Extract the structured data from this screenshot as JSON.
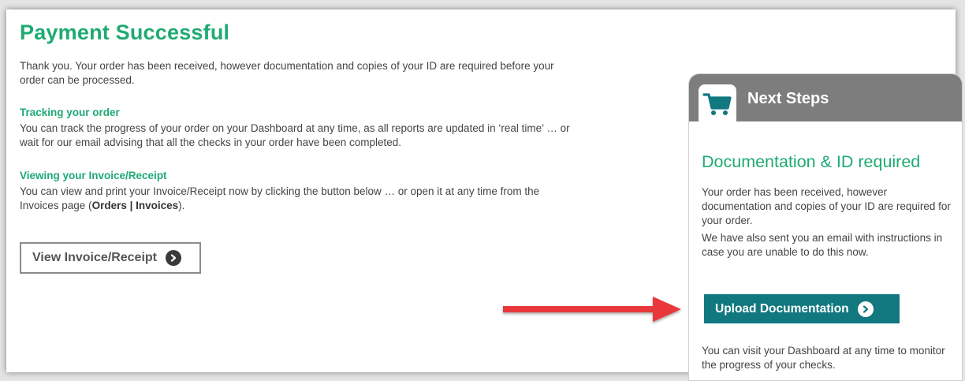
{
  "page": {
    "title": "Payment Successful",
    "intro": "Thank you. Your order has been received, however documentation and copies of your ID are required before your order can be processed."
  },
  "tracking": {
    "heading": "Tracking your order",
    "text": "You can track the progress of your order on your Dashboard at any time, as all reports are updated in ‘real time’ … or wait for our email advising that all the checks in your order have been completed."
  },
  "invoice": {
    "heading": "Viewing your Invoice/Receipt",
    "text_before": "You can view and print your Invoice/Receipt now by clicking the button below … or open it at any time from the Invoices page (",
    "text_bold": "Orders | Invoices",
    "text_after": ").",
    "button_label": "View Invoice/Receipt"
  },
  "next_steps": {
    "header": "Next Steps",
    "icon": "shopping-cart-icon",
    "subtitle": "Documentation & ID required",
    "paragraph1": "Your order has been received, however documentation and copies of your ID are required for your order.",
    "paragraph2": "We have also sent you an email with instructions in case you are unable to do this now.",
    "upload_button_label": "Upload Documentation",
    "paragraph3": "You can visit your Dashboard at any time to monitor the progress of your checks."
  },
  "colors": {
    "accent_green": "#1eaa74",
    "upload_teal": "#11787f",
    "panel_header_gray": "#7d7d7d",
    "annotation_arrow_red": "#e8393a"
  }
}
